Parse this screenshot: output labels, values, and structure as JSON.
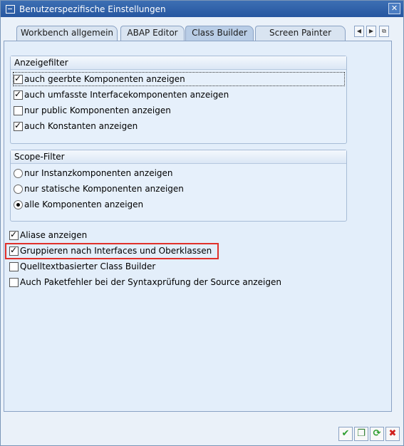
{
  "window": {
    "title": "Benutzerspezifische Einstellungen"
  },
  "tabs": [
    {
      "label": "Workbench allgemein",
      "active": false
    },
    {
      "label": "ABAP Editor",
      "active": false
    },
    {
      "label": "Class Builder",
      "active": true
    },
    {
      "label": "Screen Painter",
      "active": false
    }
  ],
  "anzeigefilter": {
    "title": "Anzeigefilter",
    "items": [
      {
        "label": "auch geerbte Komponenten anzeigen",
        "checked": true
      },
      {
        "label": "auch umfasste Interfacekomponenten anzeigen",
        "checked": true
      },
      {
        "label": "nur public Komponenten anzeigen",
        "checked": false
      },
      {
        "label": "auch Konstanten anzeigen",
        "checked": true
      }
    ]
  },
  "scopefilter": {
    "title": "Scope-Filter",
    "items": [
      {
        "label": "nur Instanzkomponenten anzeigen",
        "selected": false
      },
      {
        "label": "nur statische Komponenten anzeigen",
        "selected": false
      },
      {
        "label": "alle Komponenten anzeigen",
        "selected": true
      }
    ]
  },
  "options": [
    {
      "label": "Aliase anzeigen",
      "checked": true
    },
    {
      "label": "Gruppieren nach Interfaces und Oberklassen",
      "checked": true
    },
    {
      "label": "Quelltextbasierter Class Builder",
      "checked": false
    },
    {
      "label": "Auch Paketfehler bei der Syntaxprüfung der Source anzeigen",
      "checked": false
    }
  ],
  "colors": {
    "titlebar": "#2c5ea6",
    "highlight": "#e0302a",
    "confirm": "#2e9e2e",
    "cancel": "#d0201c"
  },
  "footer": {
    "buttons": [
      "confirm-icon",
      "copy-icon",
      "refresh-icon",
      "cancel-icon"
    ]
  }
}
